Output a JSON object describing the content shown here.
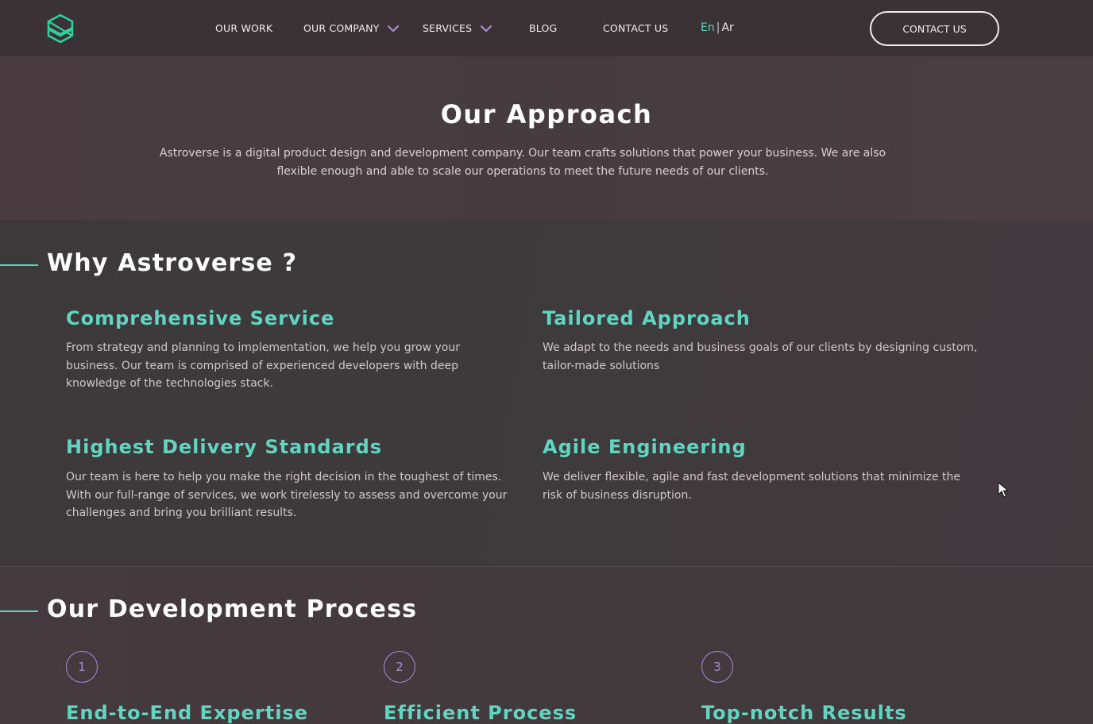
{
  "nav": {
    "items": [
      {
        "label": "OUR WORK",
        "has_dropdown": false
      },
      {
        "label": "OUR COMPANY",
        "has_dropdown": true
      },
      {
        "label": "SERVICES",
        "has_dropdown": true
      },
      {
        "label": "BLOG",
        "has_dropdown": false
      },
      {
        "label": "CONTACT US",
        "has_dropdown": false
      }
    ],
    "lang_en": "En",
    "lang_sep": "|",
    "lang_ar": "Ar",
    "cta_label": "CONTACT US",
    "logo_icon": "cube-logo-icon",
    "chevron_icon": "chevron-down-icon"
  },
  "hero": {
    "title": "Our Approach",
    "text": "Astroverse is a digital product design and development company. Our team crafts solutions that power your business. We are also flexible enough and able to scale our operations to meet the future needs of our clients."
  },
  "why": {
    "title": "Why Astroverse ?",
    "features": [
      {
        "title": "Comprehensive Service",
        "text": "From strategy and planning to implementation, we help you grow your business. Our team is comprised of experienced developers with deep knowledge of the technologies stack."
      },
      {
        "title": "Tailored Approach",
        "text": "We adapt to the needs and business goals of our clients by designing custom, tailor-made solutions"
      },
      {
        "title": "Highest Delivery Standards",
        "text": "Our team is here to help you make the right decision in the toughest of times. With our full-range of services, we work tirelessly to assess and overcome your challenges and bring you brilliant results."
      },
      {
        "title": "Agile Engineering",
        "text": "We deliver flexible, agile and fast development solutions that minimize the risk of business disruption."
      }
    ]
  },
  "process": {
    "title": "Our Development Process",
    "steps": [
      {
        "number": "1",
        "title": "End-to-End Expertise"
      },
      {
        "number": "2",
        "title": "Efficient Process"
      },
      {
        "number": "3",
        "title": "Top-notch Results"
      }
    ]
  },
  "colors": {
    "accent": "#57d6bd",
    "feature_title": "#62d5c0",
    "step_circle": "#a98cd6",
    "background": "#3b3538"
  }
}
